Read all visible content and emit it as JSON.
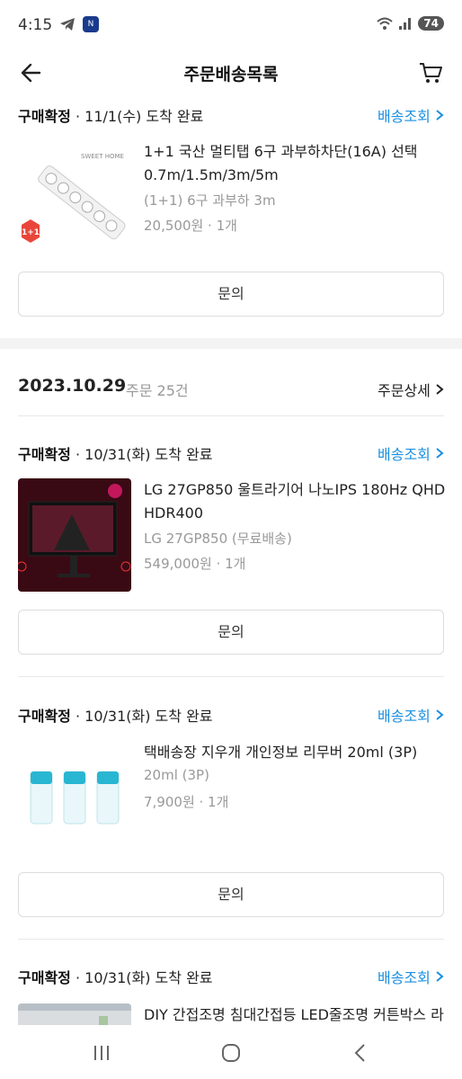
{
  "status_bar": {
    "time": "4:15",
    "battery": "74"
  },
  "header": {
    "title": "주문배송목록"
  },
  "orders": [
    {
      "status_label": "구매확정",
      "status_detail": " · 11/1(수) 도착 완료",
      "track_label": "배송조회",
      "product_name": "1+1 국산 멀티탭 6구 과부하차단(16A) 선택 0.7m/1.5m/3m/5m",
      "option": "(1+1) 6구 과부하 3m",
      "price": "20,500원 · 1개",
      "image_badge": "1+1",
      "image_brand": "SWEET HOME",
      "inquiry_label": "문의"
    }
  ],
  "group": {
    "date": "2023.10.29",
    "count": "주문 25건",
    "detail_label": "주문상세"
  },
  "group_orders": [
    {
      "status_label": "구매확정",
      "status_detail": " · 10/31(화) 도착 완료",
      "track_label": "배송조회",
      "product_name": "LG 27GP850 울트라기어 나노IPS 180Hz QHD HDR400",
      "option": "LG 27GP850 (무료배송)",
      "price": "549,000원 · 1개",
      "inquiry_label": "문의"
    },
    {
      "status_label": "구매확정",
      "status_detail": " · 10/31(화) 도착 완료",
      "track_label": "배송조회",
      "product_name": "택배송장 지우개 개인정보 리무버 20ml (3P)",
      "option": "20ml (3P)",
      "price": "7,900원 · 1개",
      "inquiry_label": "문의"
    },
    {
      "status_label": "구매확정",
      "status_detail": " · 10/31(화) 도착 완료",
      "track_label": "배송조회",
      "product_name": "DIY 간접조명 침대간접등 LED줄조명 커튼박스 라"
    }
  ],
  "icons": {
    "back": "arrow-left-icon",
    "cart": "cart-icon",
    "chevron": "chevron-right-icon",
    "nav_recent": "recent-apps-icon",
    "nav_home": "home-icon",
    "nav_back": "back-icon"
  },
  "colors": {
    "link": "#1a8fe0",
    "badge": "#e8463b"
  }
}
